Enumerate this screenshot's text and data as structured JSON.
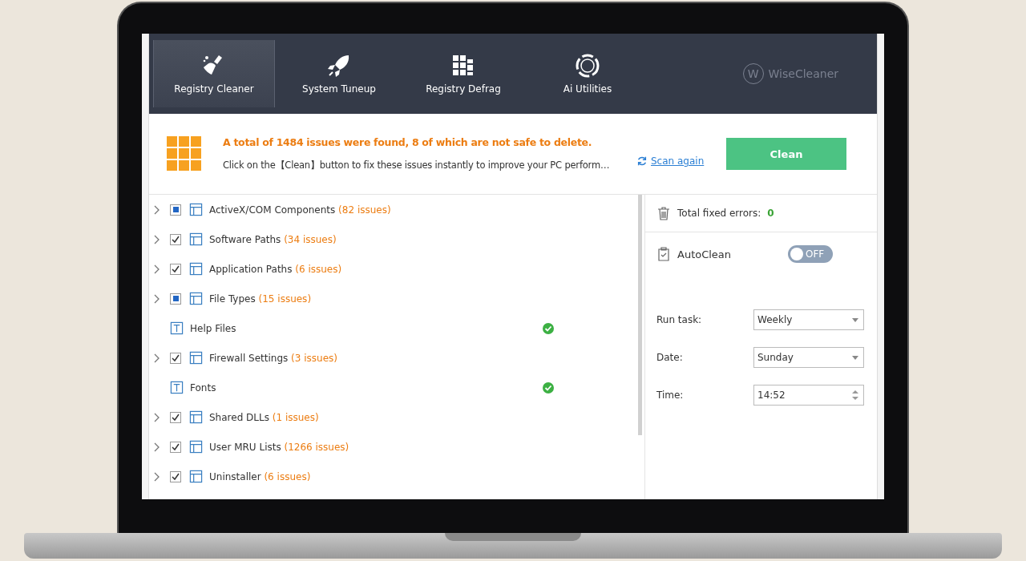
{
  "tabs": [
    {
      "label": "Registry Cleaner",
      "selected": true
    },
    {
      "label": "System Tuneup",
      "selected": false
    },
    {
      "label": "Registry Defrag",
      "selected": false
    },
    {
      "label": "Ai Utilities",
      "selected": false
    }
  ],
  "brand": {
    "initial": "W",
    "name": "WiseCleaner"
  },
  "banner": {
    "headline": "A total of 1484 issues were found, 8 of which are not safe to delete.",
    "hint": "Click on the【Clean】button to fix these issues instantly to improve your PC perform…",
    "scan_link": "Scan again",
    "clean_button": "Clean"
  },
  "categories": [
    {
      "kind": "issues",
      "name": "ActiveX/COM Components",
      "count": "(82 issues)",
      "checked": true,
      "partial": true
    },
    {
      "kind": "issues",
      "name": "Software Paths",
      "count": "(34 issues)",
      "checked": true,
      "partial": false
    },
    {
      "kind": "issues",
      "name": "Application Paths",
      "count": "(6 issues)",
      "checked": true,
      "partial": false
    },
    {
      "kind": "issues",
      "name": "File Types",
      "count": "(15 issues)",
      "checked": true,
      "partial": true
    },
    {
      "kind": "clean",
      "name": "Help Files"
    },
    {
      "kind": "issues",
      "name": "Firewall Settings",
      "count": "(3 issues)",
      "checked": true,
      "partial": false
    },
    {
      "kind": "clean",
      "name": "Fonts"
    },
    {
      "kind": "issues",
      "name": "Shared DLLs",
      "count": "(1 issues)",
      "checked": true,
      "partial": false
    },
    {
      "kind": "issues",
      "name": "User MRU Lists",
      "count": "(1266 issues)",
      "checked": true,
      "partial": false
    },
    {
      "kind": "issues",
      "name": "Uninstaller",
      "count": "(6 issues)",
      "checked": true,
      "partial": false
    }
  ],
  "side": {
    "fixed_label": "Total fixed errors:",
    "fixed_value": "0",
    "autoclean": {
      "label": "AutoClean",
      "on": false,
      "state_text": "OFF"
    },
    "fields": [
      {
        "label": "Run task:",
        "value": "Weekly",
        "kind": "dropdown"
      },
      {
        "label": "Date:",
        "value": "Sunday",
        "kind": "dropdown"
      },
      {
        "label": "Time:",
        "value": "14:52",
        "kind": "spinner"
      }
    ]
  }
}
